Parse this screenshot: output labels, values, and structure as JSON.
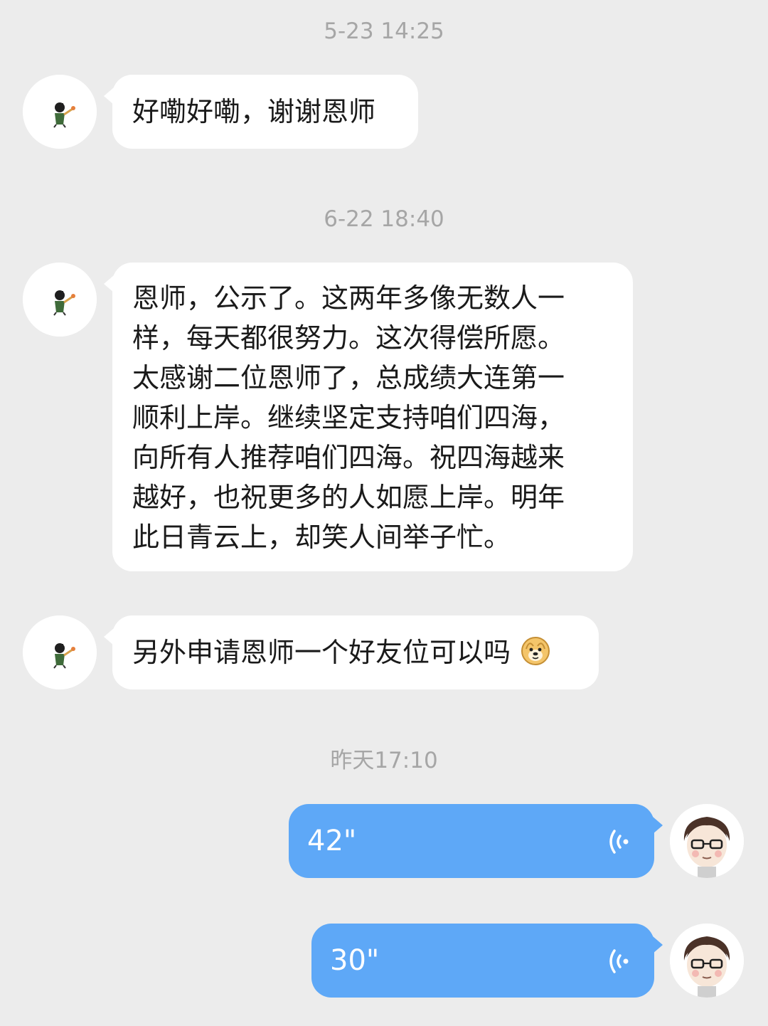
{
  "messages": [
    {
      "type": "timestamp",
      "text": "5-23 14:25"
    },
    {
      "type": "incoming",
      "text": "好嘞好嘞，谢谢恩师"
    },
    {
      "type": "timestamp",
      "text": "6-22 18:40"
    },
    {
      "type": "incoming",
      "lines": [
        "恩师，公示了。这两年多像无数人一",
        "样，每天都很努力。这次得偿所愿。",
        "太感谢二位恩师了，总成绩大连第一",
        "顺利上岸。继续坚定支持咱们四海，",
        "向所有人推荐咱们四海。祝四海越来",
        "越好，也祝更多的人如愿上岸。明年",
        "此日青云上，却笑人间举子忙。"
      ]
    },
    {
      "type": "incoming",
      "text": "另外申请恩师一个好友位可以吗",
      "emoji": "doge-emoji"
    },
    {
      "type": "timestamp",
      "text": "昨天17:10"
    },
    {
      "type": "outgoing-voice",
      "duration": "42\"",
      "icon": "voice-wave-icon"
    },
    {
      "type": "outgoing-voice",
      "duration": "30\"",
      "icon": "voice-wave-icon"
    }
  ],
  "avatars": {
    "contact": "contact-avatar-cartoon",
    "self": "self-avatar-cartoon"
  },
  "colors": {
    "background": "#ececec",
    "incoming_bubble": "#ffffff",
    "outgoing_bubble": "#5ea8f7",
    "timestamp_text": "#a6a6a6"
  }
}
